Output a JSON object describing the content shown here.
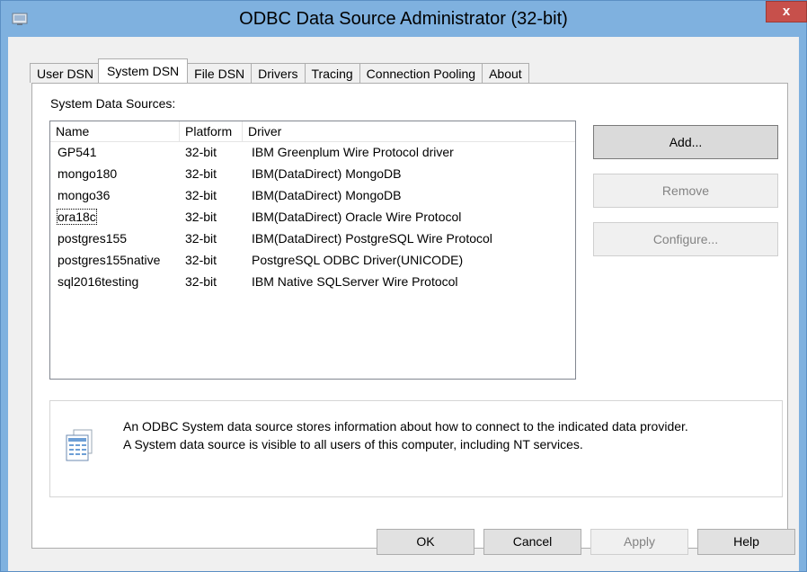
{
  "window": {
    "title": "ODBC Data Source Administrator (32-bit)",
    "close_label": "x"
  },
  "tabs": [
    {
      "label": "User DSN",
      "active": false
    },
    {
      "label": "System DSN",
      "active": true
    },
    {
      "label": "File DSN",
      "active": false
    },
    {
      "label": "Drivers",
      "active": false
    },
    {
      "label": "Tracing",
      "active": false
    },
    {
      "label": "Connection Pooling",
      "active": false
    },
    {
      "label": "About",
      "active": false
    }
  ],
  "system_dsn": {
    "section_label": "System Data Sources:",
    "columns": [
      "Name",
      "Platform",
      "Driver"
    ],
    "rows": [
      {
        "name": "GP541",
        "platform": "32-bit",
        "driver": "IBM Greenplum Wire Protocol driver"
      },
      {
        "name": "mongo180",
        "platform": "32-bit",
        "driver": "IBM(DataDirect)  MongoDB"
      },
      {
        "name": "mongo36",
        "platform": "32-bit",
        "driver": "IBM(DataDirect)  MongoDB"
      },
      {
        "name": "ora18c",
        "platform": "32-bit",
        "driver": "IBM(DataDirect)  Oracle Wire Protocol"
      },
      {
        "name": "postgres155",
        "platform": "32-bit",
        "driver": "IBM(DataDirect)  PostgreSQL Wire Protocol"
      },
      {
        "name": "postgres155native",
        "platform": "32-bit",
        "driver": "PostgreSQL ODBC Driver(UNICODE)"
      },
      {
        "name": "sql2016testing",
        "platform": "32-bit",
        "driver": "IBM Native SQLServer Wire Protocol"
      }
    ],
    "buttons": {
      "add": "Add...",
      "remove": "Remove",
      "configure": "Configure..."
    },
    "info_text_line1": "An ODBC System data source stores information about how to connect to the indicated data provider.",
    "info_text_line2": "A System data source is visible to all users of this computer, including NT services."
  },
  "footer": {
    "ok": "OK",
    "cancel": "Cancel",
    "apply": "Apply",
    "help": "Help"
  },
  "colors": {
    "titlebar": "#7fb1df",
    "close_button": "#c7504b",
    "client_bg": "#f0f0f0"
  }
}
